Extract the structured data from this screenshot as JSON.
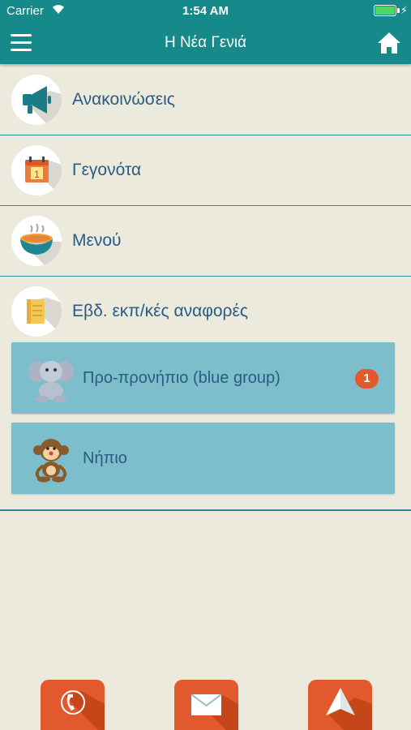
{
  "status": {
    "carrier": "Carrier",
    "time": "1:54 AM"
  },
  "navbar": {
    "title": "Η Νέα Γενιά",
    "menu_icon": "hamburger-menu-icon",
    "home_icon": "home-icon"
  },
  "menu": {
    "announcements": "Ανακοινώσεις",
    "events": "Γεγονότα",
    "events_calendar_day": "1",
    "menu": "Μενού",
    "reports": "Εβδ. εκπ/κές αναφορές"
  },
  "groups": [
    {
      "label": "Προ-προνήπιο (blue group)",
      "badge": "1",
      "icon": "elephant-icon"
    },
    {
      "label": "Νήπιο",
      "icon": "monkey-icon"
    }
  ],
  "footer": {
    "icons": [
      "phone-icon",
      "envelope-icon",
      "map-arrow-icon"
    ]
  },
  "colors": {
    "primary": "#16898b",
    "background": "#ebeadd",
    "accent": "#e2592d",
    "group_bg": "#7dbecc",
    "label_text": "#2b5a83"
  }
}
